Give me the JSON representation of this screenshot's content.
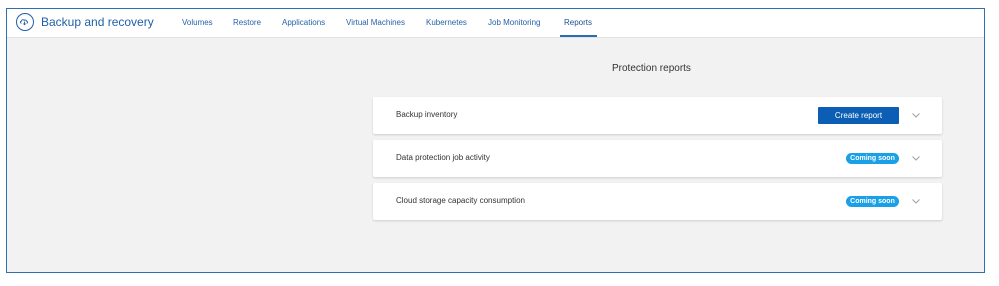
{
  "app": {
    "title": "Backup and recovery"
  },
  "nav": {
    "items": [
      {
        "label": "Volumes"
      },
      {
        "label": "Restore"
      },
      {
        "label": "Applications"
      },
      {
        "label": "Virtual Machines"
      },
      {
        "label": "Kubernetes"
      },
      {
        "label": "Job Monitoring"
      },
      {
        "label": "Reports"
      }
    ],
    "active": "Reports"
  },
  "main": {
    "heading": "Protection reports",
    "reports": [
      {
        "title": "Backup inventory",
        "action_label": "Create report"
      },
      {
        "title": "Data protection job activity",
        "badge": "Coming soon"
      },
      {
        "title": "Cloud storage capacity consumption",
        "badge": "Coming soon"
      }
    ]
  },
  "colors": {
    "accent": "#0b5eb3",
    "nav_text": "#2563a8",
    "badge": "#1aa0e6",
    "frame_border": "#2f6fb3",
    "background": "#f2f2f2"
  },
  "icons": {
    "app": "cloud-sync-icon",
    "expand": "chevron-down-icon"
  }
}
